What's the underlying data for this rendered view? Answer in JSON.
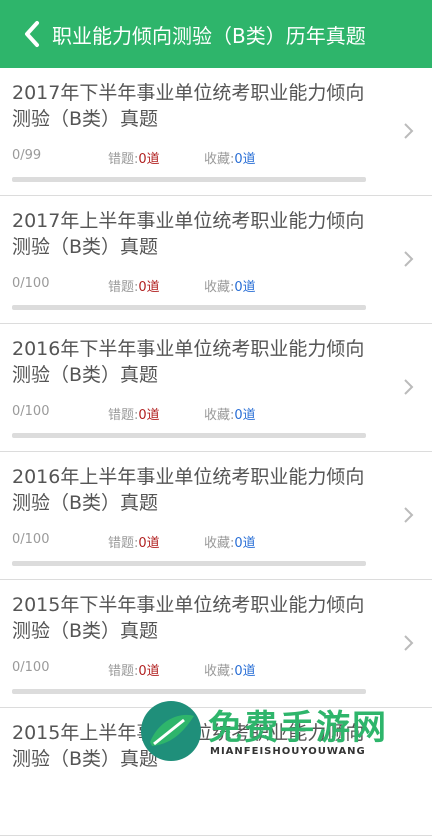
{
  "header": {
    "title": "职业能力倾向测验（B类）历年真题"
  },
  "items": [
    {
      "title": "2017年下半年事业单位统考职业能力倾向测验（B类）真题",
      "progress": "0/99",
      "wrong_label": "错题:",
      "wrong_count": "0道",
      "fav_label": "收藏:",
      "fav_count": "0道",
      "completion": 0
    },
    {
      "title": "2017年上半年事业单位统考职业能力倾向测验（B类）真题",
      "progress": "0/100",
      "wrong_label": "错题:",
      "wrong_count": "0道",
      "fav_label": "收藏:",
      "fav_count": "0道",
      "completion": 0
    },
    {
      "title": "2016年下半年事业单位统考职业能力倾向测验（B类）真题",
      "progress": "0/100",
      "wrong_label": "错题:",
      "wrong_count": "0道",
      "fav_label": "收藏:",
      "fav_count": "0道",
      "completion": 0
    },
    {
      "title": "2016年上半年事业单位统考职业能力倾向测验（B类）真题",
      "progress": "0/100",
      "wrong_label": "错题:",
      "wrong_count": "0道",
      "fav_label": "收藏:",
      "fav_count": "0道",
      "completion": 0
    },
    {
      "title": "2015年下半年事业单位统考职业能力倾向测验（B类）真题",
      "progress": "0/100",
      "wrong_label": "错题:",
      "wrong_count": "0道",
      "fav_label": "收藏:",
      "fav_count": "0道",
      "completion": 0
    },
    {
      "title": "2015年上半年事业单位统考职业能力倾向测验（B类）真题",
      "progress": "",
      "wrong_label": "",
      "wrong_count": "",
      "fav_label": "",
      "fav_count": "",
      "completion": 0
    }
  ],
  "watermark": {
    "text": "免费手游网",
    "sub": "MIANFEISHOUYOUWANG"
  },
  "colors": {
    "header_bg": "#2eb56b",
    "wrong_count": "#b22222",
    "fav_count": "#2a6fd6"
  }
}
